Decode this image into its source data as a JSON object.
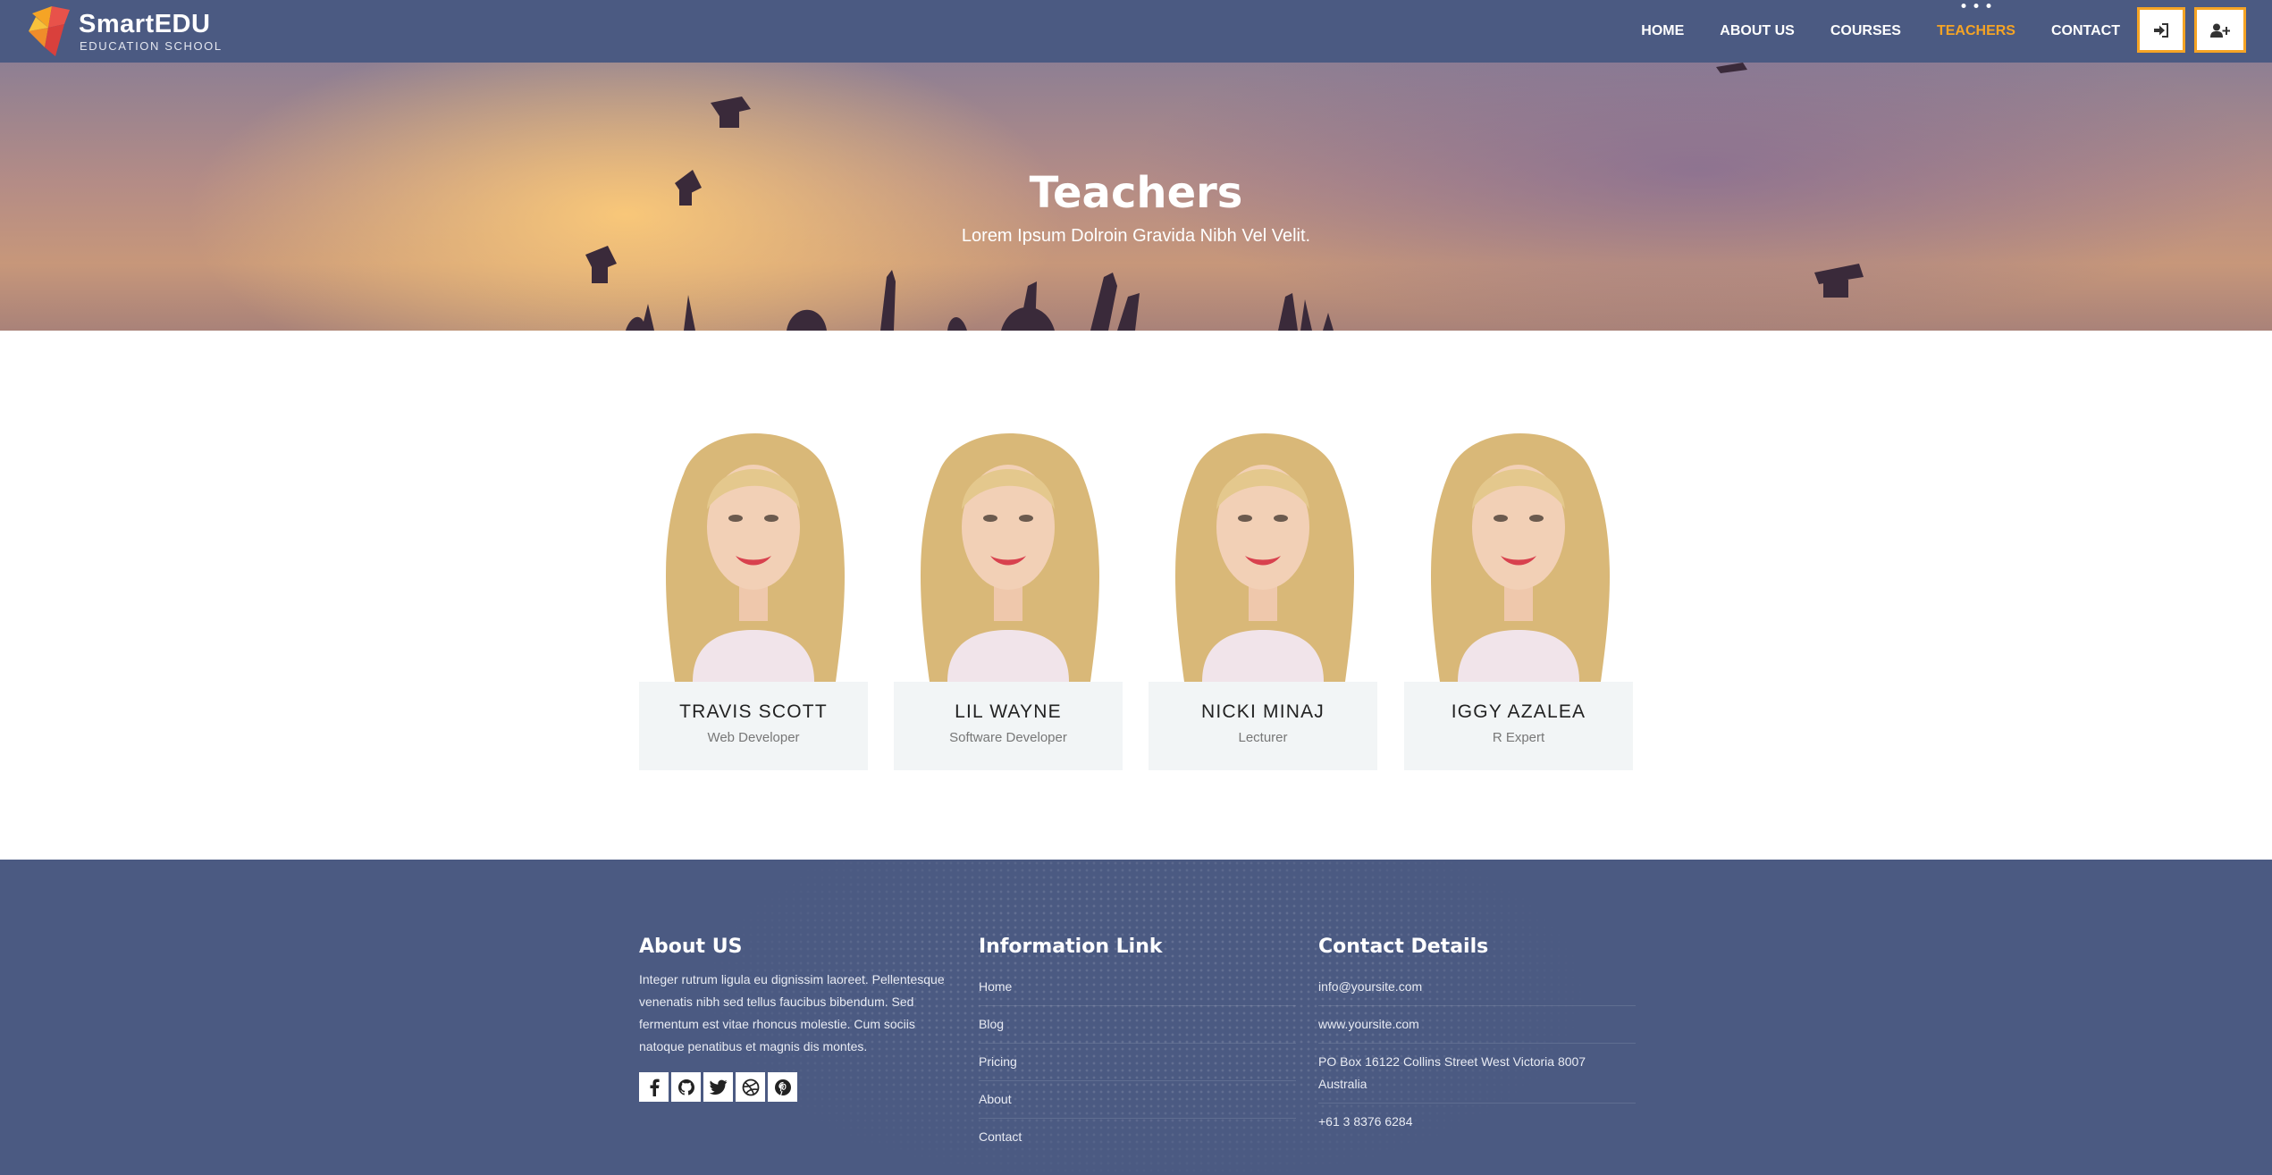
{
  "header": {
    "logo_name": "SmartEDU",
    "logo_sub": "EDUCATION SCHOOL",
    "nav": [
      {
        "label": "HOME",
        "active": false
      },
      {
        "label": "ABOUT US",
        "active": false
      },
      {
        "label": "COURSES",
        "active": false
      },
      {
        "label": "TEACHERS",
        "active": true
      },
      {
        "label": "CONTACT",
        "active": false
      }
    ],
    "login_icon": "sign-in-icon",
    "register_icon": "user-plus-icon",
    "accent_color": "#f5a425",
    "bar_color": "#4b5a82"
  },
  "hero": {
    "title": "Teachers",
    "subtitle": "Lorem Ipsum Dolroin Gravida Nibh Vel Velit."
  },
  "teachers": [
    {
      "name": "TRAVIS SCOTT",
      "role": "Web Developer"
    },
    {
      "name": "LIL WAYNE",
      "role": "Software Developer"
    },
    {
      "name": "NICKI MINAJ",
      "role": "Lecturer"
    },
    {
      "name": "IGGY AZALEA",
      "role": "R Expert"
    }
  ],
  "footer": {
    "about": {
      "title": "About US",
      "text": "Integer rutrum ligula eu dignissim laoreet. Pellentesque venenatis nibh sed tellus faucibus bibendum. Sed fermentum est vitae rhoncus molestie. Cum sociis natoque penatibus et magnis dis montes.",
      "socials": [
        "facebook-icon",
        "github-icon",
        "twitter-icon",
        "dribbble-icon",
        "pinterest-icon"
      ]
    },
    "links": {
      "title": "Information Link",
      "items": [
        "Home",
        "Blog",
        "Pricing",
        "About",
        "Contact"
      ]
    },
    "contact": {
      "title": "Contact Details",
      "items": [
        "info@yoursite.com",
        "www.yoursite.com",
        "PO Box 16122 Collins Street West Victoria 8007 Australia",
        "+61 3 8376 6284"
      ]
    }
  }
}
